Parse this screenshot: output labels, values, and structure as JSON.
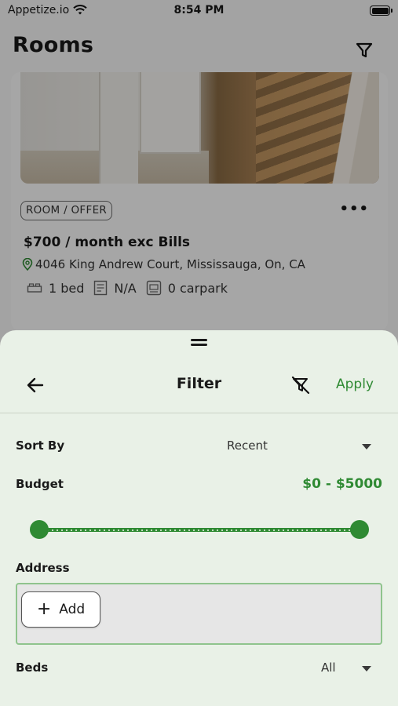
{
  "status_bar": {
    "carrier": "Appetize.io",
    "time": "8:54 PM"
  },
  "page": {
    "title": "Rooms",
    "listing": {
      "tag": "ROOM / OFFER",
      "price": "$700 / month exc Bills",
      "address": "4046 King Andrew Court, Mississauga, On, CA",
      "beds": "1 bed",
      "bath": "N/A",
      "parking": "0 carpark"
    }
  },
  "filter": {
    "title": "Filter",
    "apply_label": "Apply",
    "sort_by": {
      "label": "Sort By",
      "value": "Recent"
    },
    "budget": {
      "label": "Budget",
      "value": "$0 - $5000",
      "min_fraction": 0,
      "max_fraction": 1
    },
    "address": {
      "label": "Address",
      "add_label": "Add"
    },
    "beds": {
      "label": "Beds",
      "value": "All"
    }
  },
  "colors": {
    "accent": "#2f8a33",
    "sheet_bg": "#e9f1e7"
  },
  "icons": [
    "wifi-icon",
    "battery-icon",
    "filter-icon",
    "more-icon",
    "location-pin-icon",
    "bed-icon",
    "bath-icon",
    "parking-icon",
    "back-arrow-icon",
    "clear-filter-icon",
    "plus-icon",
    "dropdown-caret-icon"
  ]
}
